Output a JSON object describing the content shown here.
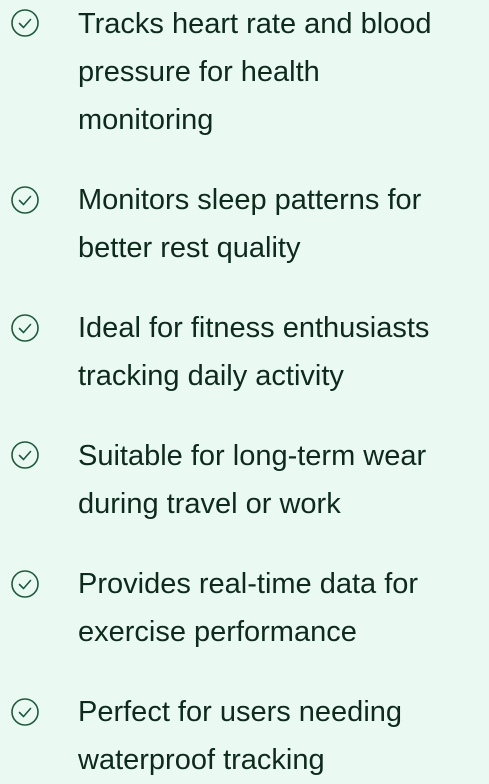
{
  "features": {
    "items": [
      {
        "lines": [
          "Tracks heart rate and blood",
          "pressure for health",
          "monitoring"
        ],
        "icon": "check-circle-icon"
      },
      {
        "lines": [
          "Monitors sleep patterns for",
          "better rest quality"
        ],
        "icon": "check-circle-icon"
      },
      {
        "lines": [
          "Ideal for fitness enthusiasts",
          "tracking daily activity"
        ],
        "icon": "check-circle-icon"
      },
      {
        "lines": [
          "Suitable for long-term wear",
          "during travel or work"
        ],
        "icon": "check-circle-icon"
      },
      {
        "lines": [
          "Provides real-time data for",
          "exercise performance"
        ],
        "icon": "check-circle-icon"
      },
      {
        "lines": [
          "Perfect for users needing",
          "waterproof tracking"
        ],
        "icon": "check-circle-icon"
      }
    ]
  },
  "colors": {
    "background": "#eafaf3",
    "text": "#0d2a1c",
    "icon": "#1f5a3c"
  }
}
